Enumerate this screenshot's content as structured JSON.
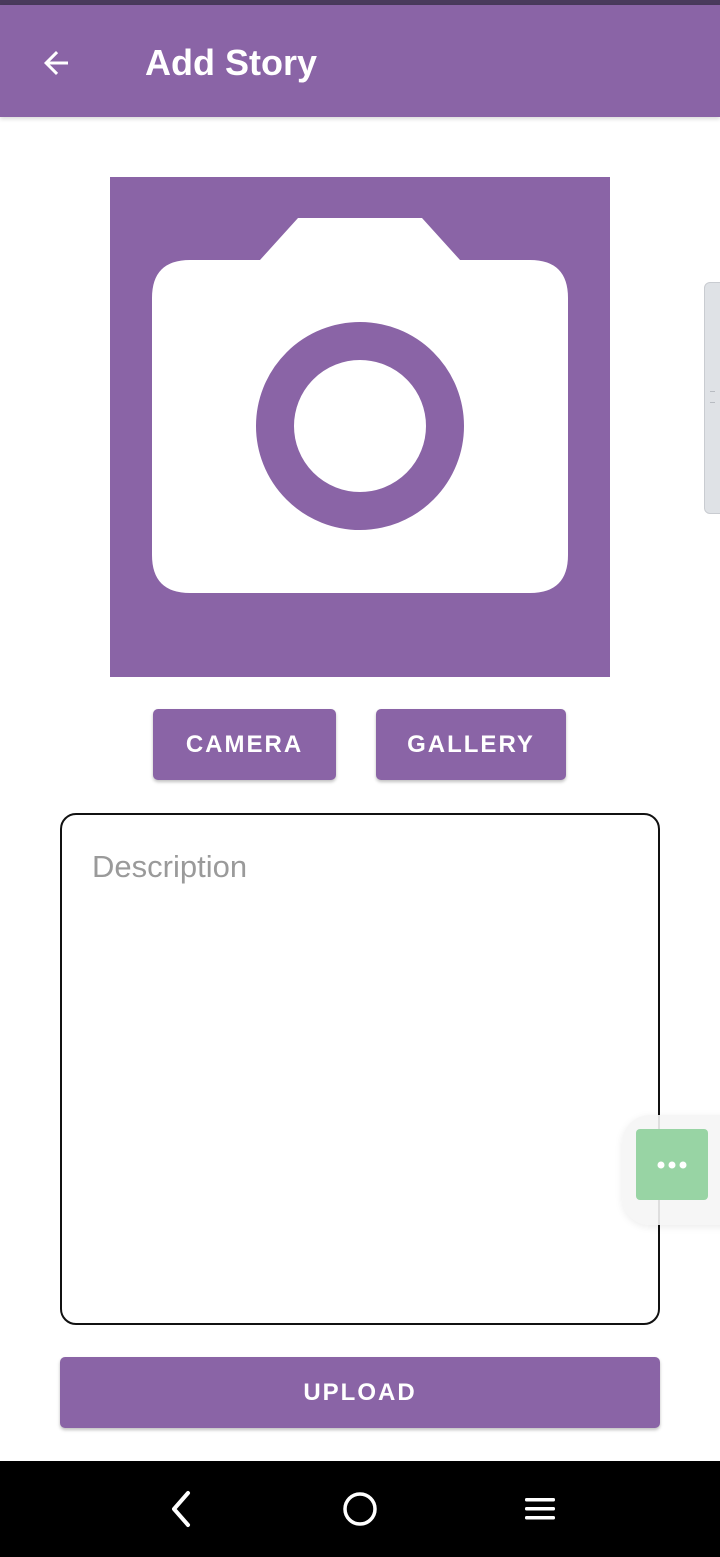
{
  "app_bar": {
    "title": "Add Story",
    "back_icon": "arrow-left-icon",
    "color": "#8a64a6"
  },
  "preview": {
    "placeholder_icon": "camera-icon",
    "background": "#8a64a6"
  },
  "buttons": {
    "camera_label": "CAMERA",
    "gallery_label": "GALLERY",
    "upload_label": "UPLOAD"
  },
  "description": {
    "placeholder": "Description",
    "value": ""
  },
  "floating_menu": {
    "icon": "more-horizontal-icon",
    "color": "#98d4a4"
  },
  "system_nav": {
    "back_icon": "nav-back-icon",
    "home_icon": "nav-home-icon",
    "menu_icon": "nav-menu-icon"
  }
}
